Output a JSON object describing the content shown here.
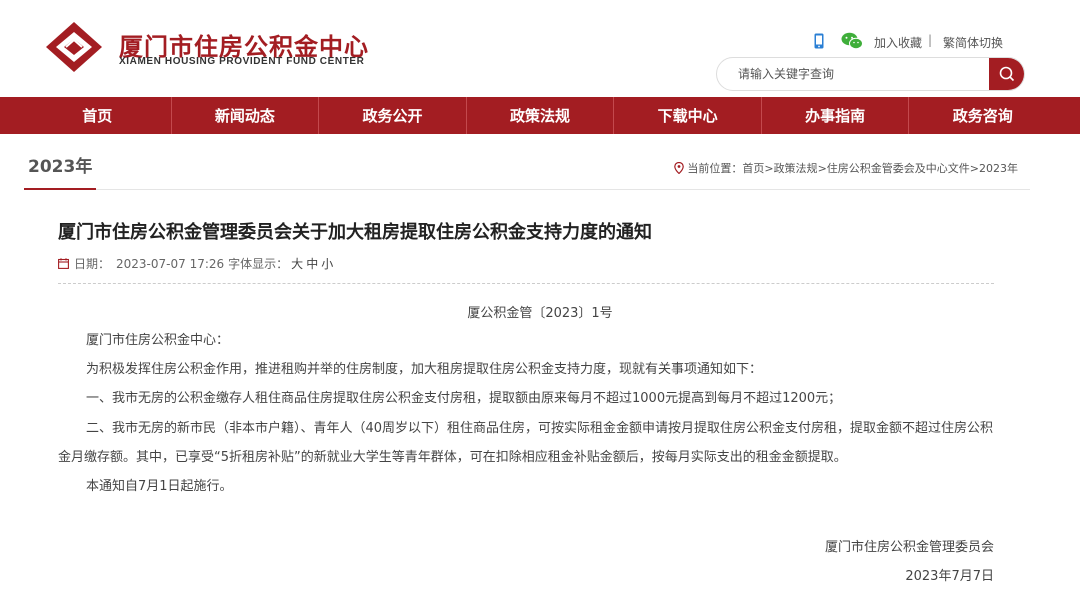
{
  "header": {
    "title": "厦门市住房公积金中心",
    "title_en": "XIAMEN HOUSING PROVIDENT FUND CENTER",
    "add_favorite": "加入收藏",
    "separator": "|",
    "lang_switch": "繁简体切换",
    "search_placeholder": "请输入关键字查询",
    "brand_color": "#a31d22",
    "icons": [
      "phone-icon",
      "wechat-icon",
      "search-icon"
    ]
  },
  "nav": {
    "items": [
      {
        "label": "首页"
      },
      {
        "label": "新闻动态"
      },
      {
        "label": "政务公开"
      },
      {
        "label": "政策法规"
      },
      {
        "label": "下载中心"
      },
      {
        "label": "办事指南"
      },
      {
        "label": "政务咨询"
      }
    ]
  },
  "section": {
    "title": "2023年",
    "breadcrumb_prefix": "当前位置：",
    "crumbs": [
      "首页",
      "政策法规",
      "住房公积金管委会及中心文件",
      "2023年"
    ],
    "crumb_sep": ">"
  },
  "article": {
    "title": "厦门市住房公积金管理委员会关于加大租房提取住房公积金支持力度的通知",
    "date_label": "日期：",
    "date": "2023-07-07 17:26",
    "font_label": "字体显示：",
    "font_sizes": [
      "大",
      "中",
      "小"
    ],
    "doc_number": "厦公积金管〔2023〕1号",
    "paragraphs": [
      "厦门市住房公积金中心：",
      "为积极发挥住房公积金作用，推进租购并举的住房制度，加大租房提取住房公积金支持力度，现就有关事项通知如下：",
      "一、我市无房的公积金缴存人租住商品住房提取住房公积金支付房租，提取额由原来每月不超过1000元提高到每月不超过1200元；",
      "二、我市无房的新市民（非本市户籍）、青年人（40周岁以下）租住商品住房，可按实际租金金额申请按月提取住房公积金支付房租，提取金额不超过住房公积金月缴存额。其中，已享受“5折租房补贴”的新就业大学生等青年群体，可在扣除相应租金补贴金额后，按每月实际支出的租金金额提取。",
      "本通知自7月1日起施行。"
    ],
    "signature": "厦门市住房公积金管理委员会",
    "sign_date": "2023年7月7日"
  }
}
